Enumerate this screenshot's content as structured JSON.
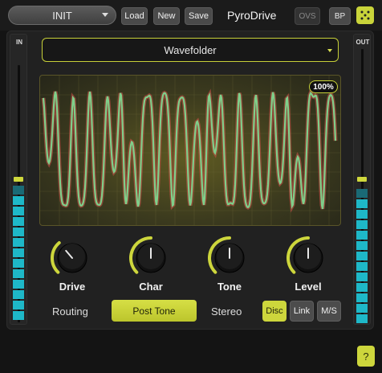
{
  "header": {
    "preset_name": "INIT",
    "load_label": "Load",
    "new_label": "New",
    "save_label": "Save",
    "title": "PyroDrive",
    "ovs_label": "OVS",
    "bp_label": "BP"
  },
  "meters": {
    "in_label": "IN",
    "out_label": "OUT"
  },
  "mode": {
    "selected": "Wavefolder"
  },
  "scope": {
    "zoom": "100%"
  },
  "knobs": [
    {
      "label": "Drive",
      "level": 0.35
    },
    {
      "label": "Char",
      "level": 0.5
    },
    {
      "label": "Tone",
      "level": 0.5
    },
    {
      "label": "Level",
      "level": 0.5
    }
  ],
  "routing": {
    "label": "Routing",
    "value": "Post Tone"
  },
  "stereo": {
    "label": "Stereo",
    "options": [
      "Disc",
      "Link",
      "M/S"
    ],
    "selected": "Disc"
  },
  "footer": {
    "help_label": "?"
  },
  "colors": {
    "accent": "#cdd63c",
    "meter": "#1eb8c8",
    "wave": "#7fcf8a",
    "wave_peak": "#d2504a"
  }
}
